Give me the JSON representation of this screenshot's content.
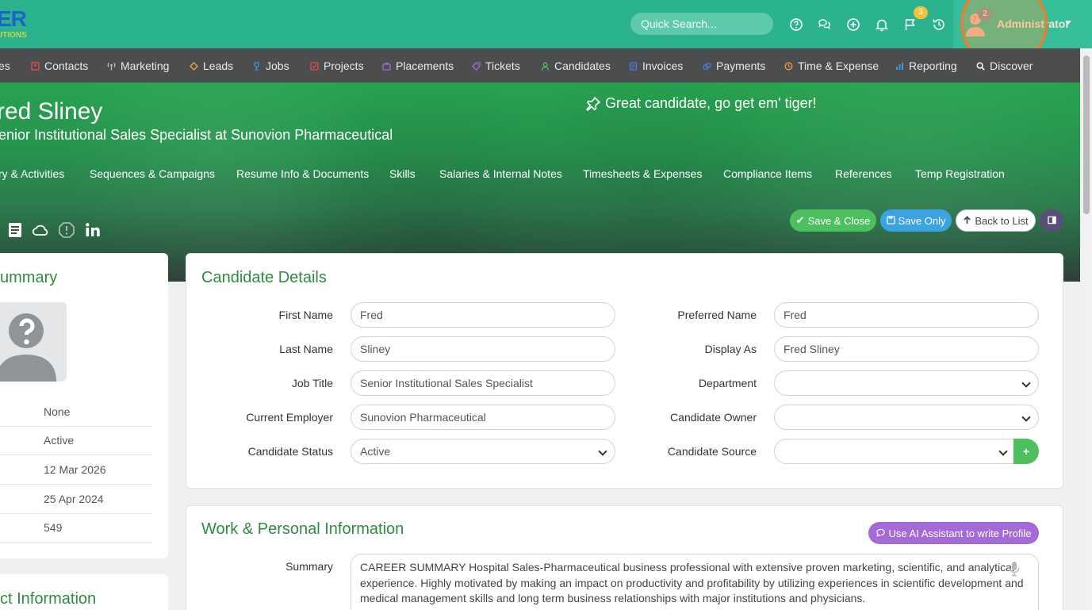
{
  "app": {
    "logo_big": "ER",
    "logo_small": "UTIONS"
  },
  "topbar": {
    "search_placeholder": "Quick Search...",
    "flag_badge": "3",
    "user_badge": "2",
    "user_name": "Administrator",
    "icons": [
      "help-icon",
      "chat-icon",
      "add-circle-icon",
      "bell-icon",
      "flag-icon",
      "history-icon"
    ]
  },
  "nav": {
    "items": [
      {
        "label": "es",
        "icon": "none"
      },
      {
        "label": "Contacts",
        "icon": "contacts-icon",
        "color": "#e84a4a"
      },
      {
        "label": "Marketing",
        "icon": "broadcast-icon",
        "color": "#c8c8c8"
      },
      {
        "label": "Leads",
        "icon": "diamond-icon",
        "color": "#f2a23a"
      },
      {
        "label": "Jobs",
        "icon": "trophy-icon",
        "color": "#3a9be0"
      },
      {
        "label": "Projects",
        "icon": "checklist-icon",
        "color": "#e84a4a"
      },
      {
        "label": "Placements",
        "icon": "briefcase-icon",
        "color": "#a46ad6"
      },
      {
        "label": "Tickets",
        "icon": "tag-icon",
        "color": "#a46ad6"
      },
      {
        "label": "Candidates",
        "icon": "person-icon",
        "color": "#4cbf5e"
      },
      {
        "label": "Invoices",
        "icon": "invoice-icon",
        "color": "#4d7bd8"
      },
      {
        "label": "Payments",
        "icon": "coins-icon",
        "color": "#4d7bd8"
      },
      {
        "label": "Time & Expense",
        "icon": "clock-icon",
        "color": "#f2a23a"
      },
      {
        "label": "Reporting",
        "icon": "bar-chart-icon",
        "color": "#3a9be0"
      },
      {
        "label": "Discover",
        "icon": "search-icon",
        "color": "#ffffff"
      }
    ]
  },
  "hero": {
    "name": "red Sliney",
    "subtitle": "enior Institutional Sales Specialist at Sunovion Pharmaceutical",
    "quote": "Great candidate, go get em' tiger!",
    "tabs": [
      "ry & Activities",
      "Sequences & Campaigns",
      "Resume Info & Documents",
      "Skills",
      "Salaries & Internal Notes",
      "Timesheets & Expenses",
      "Compliance Items",
      "References",
      "Temp Registration"
    ],
    "quick_icons": [
      "document-icon",
      "cloud-icon",
      "alert-hexagon-icon",
      "linkedin-icon"
    ],
    "buttons": {
      "save_close": "Save & Close",
      "save_only": "Save Only",
      "back": "Back to List"
    }
  },
  "left_panel": {
    "title": "ummary",
    "rows": [
      "None",
      "Active",
      "12 Mar 2026",
      "25 Apr 2024",
      "549"
    ],
    "title2": "ct Information"
  },
  "candidate_details": {
    "title": "Candidate Details",
    "left_fields": [
      {
        "label": "First Name",
        "value": "Fred"
      },
      {
        "label": "Last Name",
        "value": "Sliney"
      },
      {
        "label": "Job Title",
        "value": "Senior Institutional Sales Specialist"
      },
      {
        "label": "Current Employer",
        "value": "Sunovion Pharmaceutical"
      },
      {
        "label": "Candidate Status",
        "value": "Active"
      }
    ],
    "right_fields": [
      {
        "label": "Preferred Name",
        "value": "Fred"
      },
      {
        "label": "Display As",
        "value": "Fred Sliney"
      },
      {
        "label": "Department",
        "value": ""
      },
      {
        "label": "Candidate Owner",
        "value": ""
      },
      {
        "label": "Candidate Source",
        "value": ""
      }
    ],
    "plus_label": "+"
  },
  "work_info": {
    "title": "Work & Personal Information",
    "ai_button": "Use AI Assistant to write Profile",
    "summary_label": "Summary",
    "summary_text": "CAREER SUMMARY  Hospital Sales-Pharmaceutical business professional with extensive proven marketing, scientific, and analytical experience. Highly motivated by making an impact on productivity and profitability by utilizing experiences in scientific development and medical management skills and long term business relationships with major institutions and physicians."
  }
}
